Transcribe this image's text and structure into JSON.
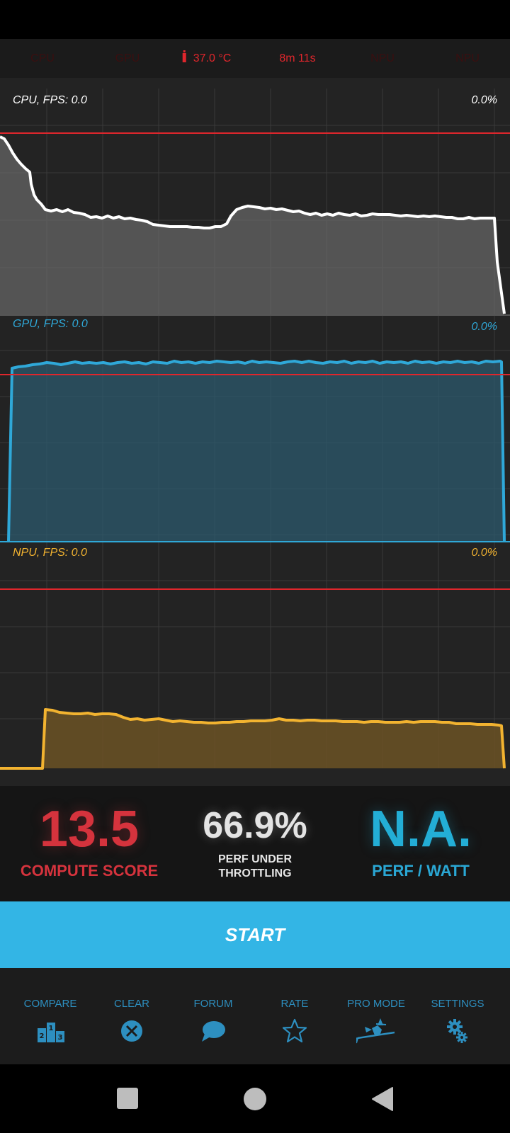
{
  "top_strip": {
    "cpu_label": "CPU",
    "gpu_label": "GPU",
    "temperature": "37.0 °C",
    "elapsed": "8m 11s",
    "npu_label_1": "NPU",
    "npu_label_2": "NPU"
  },
  "charts": {
    "cpu": {
      "label": "CPU, FPS:  0.0",
      "percent": "0.0%"
    },
    "gpu": {
      "label": "GPU, FPS:  0.0",
      "percent": "0.0%"
    },
    "npu": {
      "label": "NPU, FPS:  0.0",
      "percent": "0.0%"
    }
  },
  "scores": {
    "compute_score": "13.5",
    "compute_label": "COMPUTE SCORE",
    "throttling_value": "66.9%",
    "throttling_label_1": "PERF UNDER",
    "throttling_label_2": "THROTTLING",
    "perf_watt_value": "N.A.",
    "perf_watt_label": "PERF / WATT"
  },
  "start_label": "START",
  "toolbar": {
    "compare": "COMPARE",
    "clear": "CLEAR",
    "forum": "FORUM",
    "rate": "RATE",
    "pro_mode": "PRO MODE",
    "settings": "SETTINGS"
  },
  "colors": {
    "accent": "#33b5e5",
    "cpu_line": "#ffffff",
    "gpu_line": "#2fa8d8",
    "npu_line": "#f2b330",
    "threshold_line": "#e0262c",
    "score_red": "#d5333d",
    "score_blue": "#23aed6"
  }
}
